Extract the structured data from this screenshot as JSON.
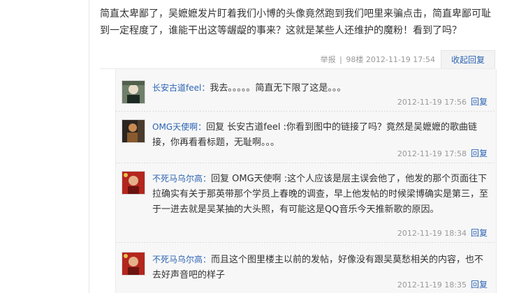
{
  "post": {
    "text": "简直太卑鄙了，吴嬷嬷发片盯着我们小博的头像竟然跑到我们吧里来骗点击，简直卑鄙可耻到一定程度了，谁能干出这等龌龊的事来？这就是某些人还维护的魔粉！看到了吗？",
    "report_label": "举报",
    "sep": "|",
    "floor": "98楼",
    "time": "2012-11-19 17:54",
    "collapse_label": "收起回复"
  },
  "replies": [
    {
      "author": "长安古道feel：",
      "text": "我去。。。。。简直无下限了这是。。。",
      "time": "2012-11-19 17:56",
      "reply_label": "回复"
    },
    {
      "author": "OMG天使啊：",
      "text": "回复 长安古道feel :你看到图中的链接了吗？竟然是吴嬷嬷的歌曲链接，你再看看标题，无耻啊。。。",
      "time": "2012-11-19 17:58",
      "reply_label": "回复"
    },
    {
      "author": "不死马乌尔高：",
      "text": "回复 OMG天使啊 :这个人应该是层主误会他了，他发的那个页面往下拉确实有关于那英带那个学员上春晚的调查，早上他发帖的时候梁博确实是第三，至于一进去就是吴某抽的大头照，有可能这是QQ音乐今天推新歌的原因。",
      "time": "2012-11-19 18:34",
      "reply_label": "回复"
    },
    {
      "author": "不死马乌尔高：",
      "text": "而且这个图里楼主以前的发帖，好像没有跟吴莫愁相关的内容，也不去好声音吧的样子",
      "time": "2012-11-19 18:35",
      "reply_label": "回复"
    }
  ],
  "colors": {
    "link": "#2d64b3",
    "meta": "#999999",
    "reply_bg": "#f7f7f7"
  }
}
